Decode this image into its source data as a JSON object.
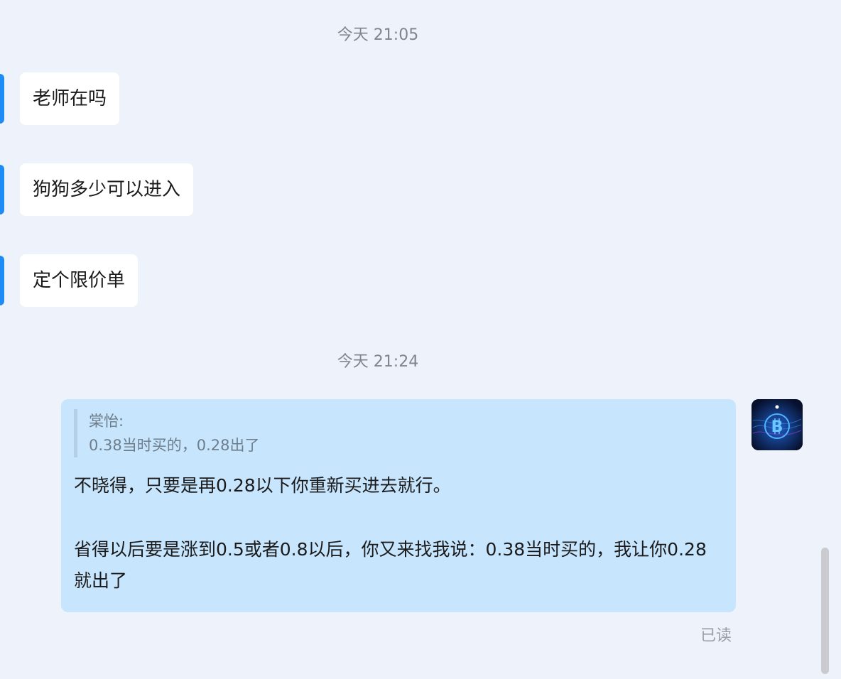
{
  "timestamps": [
    "今天 21:05",
    "今天 21:24"
  ],
  "incoming_messages": [
    "老师在吗",
    "狗狗多少可以进入",
    "定个限价单"
  ],
  "outgoing_message": {
    "quote_author": "棠怡:",
    "quote_text": "0.38当时买的，0.28出了",
    "paragraph1": "不晓得，只要是再0.28以下你重新买进去就行。",
    "paragraph2": "省得以后要是涨到0.5或者0.8以后，你又来找我说：0.38当时买的，我让你0.28就出了",
    "status": "已读"
  },
  "avatar_icon": "bitcoin-logo-icon",
  "colors": {
    "background": "#eef2fa",
    "incoming_bubble": "#ffffff",
    "outgoing_bubble": "#c7e5fd",
    "accent": "#1f8cf5"
  }
}
